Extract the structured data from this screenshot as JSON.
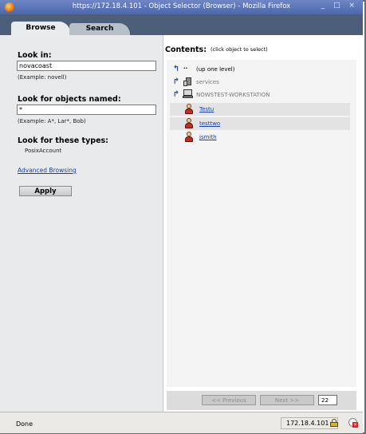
{
  "window": {
    "title": "https://172.18.4.101 - Object Selector (Browser) - Mozilla Firefox",
    "controls": "_ □ ×"
  },
  "tabs": [
    {
      "label": "Browse",
      "active": true
    },
    {
      "label": "Search",
      "active": false
    }
  ],
  "left": {
    "look_in_label": "Look in:",
    "look_in_value": "novacoast",
    "look_in_hint": "(Example: novell)",
    "named_label": "Look for objects named:",
    "named_value": "*",
    "named_hint": "(Example: A*, Lar*, Bob)",
    "types_label": "Look for these types:",
    "types_value": "PosixAccount",
    "advanced_link": "Advanced Browsing",
    "apply_label": "Apply"
  },
  "contents": {
    "title": "Contents:",
    "hint": "(click object to select)",
    "items": [
      {
        "icon": "up-arrow-icon",
        "prefix": "..",
        "label": "(up one level)",
        "style": "plain"
      },
      {
        "icon": "server-icon",
        "label": "services",
        "style": "gray"
      },
      {
        "icon": "workstation-icon",
        "label": "NOWSTEST-WORKSTATION",
        "style": "gray"
      },
      {
        "icon": "user-icon",
        "label": "Testu",
        "style": "link"
      },
      {
        "icon": "user-icon",
        "label": "testtwo",
        "style": "link"
      },
      {
        "icon": "user-icon",
        "label": "jsmith",
        "style": "link"
      }
    ],
    "pager": {
      "previous_label": "<< Previous",
      "next_label": "Next >>",
      "page_size": "22"
    }
  },
  "status": {
    "text": "Done",
    "host": "172.18.4.101"
  }
}
